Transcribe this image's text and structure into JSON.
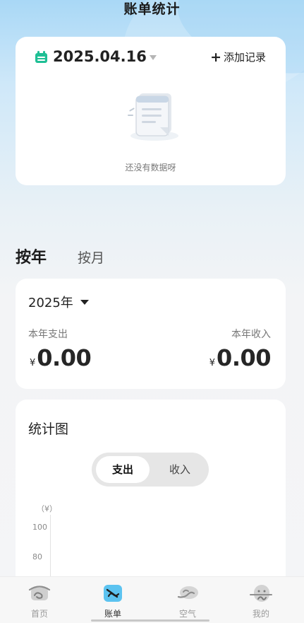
{
  "header": {
    "title": "账单统计"
  },
  "date_card": {
    "date": "2025.04.16",
    "add_record_label": "添加记录",
    "empty_text": "还没有数据呀"
  },
  "period_tabs": {
    "year": "按年",
    "month": "按月",
    "active": "year"
  },
  "year_card": {
    "year_label": "2025年",
    "expense_label": "本年支出",
    "income_label": "本年收入",
    "currency": "¥",
    "expense_value": "0.00",
    "income_value": "0.00"
  },
  "chart_card": {
    "title": "统计图",
    "toggle": {
      "expense": "支出",
      "income": "收入",
      "active": "expense"
    },
    "unit": "（¥）",
    "ticks": [
      "100",
      "80"
    ]
  },
  "tabbar": {
    "items": [
      {
        "label": "首页",
        "icon": "home-icon",
        "active": false
      },
      {
        "label": "账单",
        "icon": "bill-icon",
        "active": true
      },
      {
        "label": "空气",
        "icon": "air-icon",
        "active": false
      },
      {
        "label": "我的",
        "icon": "profile-icon",
        "active": false
      }
    ]
  },
  "colors": {
    "accent_green": "#1fbf95",
    "active_tab_blue": "#5cc3f0",
    "header_gradient_top": "#a9d8f6"
  }
}
